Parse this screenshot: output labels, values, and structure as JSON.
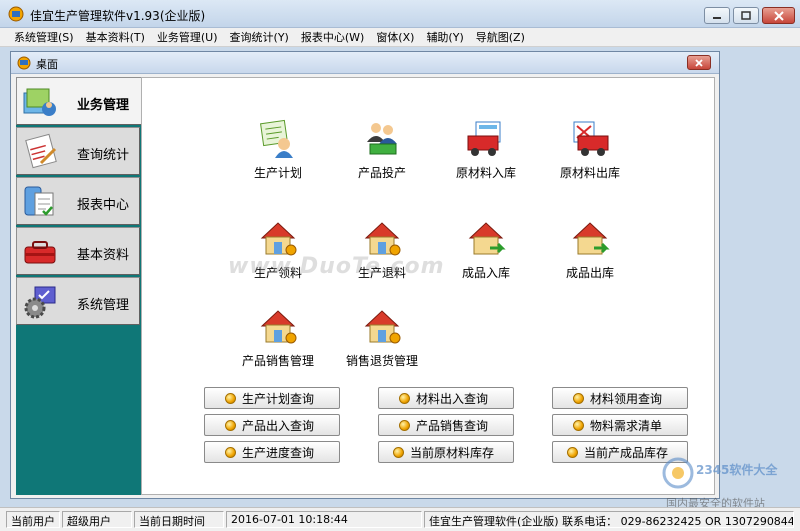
{
  "window": {
    "title": "佳宜生产管理软件v1.93(企业版)"
  },
  "menubar": [
    "系统管理(S)",
    "基本资料(T)",
    "业务管理(U)",
    "查询统计(Y)",
    "报表中心(W)",
    "窗体(X)",
    "辅助(Y)",
    "导航图(Z)"
  ],
  "desktop": {
    "title": "桌面"
  },
  "sidebar": {
    "items": [
      {
        "label": "业务管理",
        "icon": "business-icon",
        "active": true
      },
      {
        "label": "查询统计",
        "icon": "query-icon",
        "active": false
      },
      {
        "label": "报表中心",
        "icon": "report-icon",
        "active": false
      },
      {
        "label": "基本资料",
        "icon": "toolbox-icon",
        "active": false
      },
      {
        "label": "系统管理",
        "icon": "settings-gear-icon",
        "active": false
      }
    ]
  },
  "tiles": [
    {
      "label": "生产计划",
      "icon": "production-plan-icon"
    },
    {
      "label": "产品投产",
      "icon": "product-launch-icon"
    },
    {
      "label": "原材料入库",
      "icon": "material-in-icon"
    },
    {
      "label": "原材料出库",
      "icon": "material-out-icon"
    },
    {
      "label": "生产领料",
      "icon": "house-icon"
    },
    {
      "label": "生产退料",
      "icon": "house-icon"
    },
    {
      "label": "成品入库",
      "icon": "house-arrow-icon"
    },
    {
      "label": "成品出库",
      "icon": "house-arrow-icon"
    },
    {
      "label": "产品销售管理",
      "icon": "house-icon"
    },
    {
      "label": "销售退货管理",
      "icon": "house-icon"
    }
  ],
  "query_buttons": [
    "生产计划查询",
    "材料出入查询",
    "材料领用查询",
    "产品出入查询",
    "产品销售查询",
    "物料需求清单",
    "生产进度查询",
    "当前原材料库存",
    "当前产成品库存"
  ],
  "statusbar": {
    "user_label": "当前用户",
    "user_value": "超级用户",
    "datetime_label": "当前日期时间",
    "datetime_value": "2016-07-01 10:18:44",
    "info": "佳宜生产管理软件(企业版) 联系电话： 029-86232425 OR 1307290844"
  },
  "watermarks": {
    "center": "www.DuoTe.com",
    "corner_brand": "2345软件大全",
    "corner_text": "国内最安全的软件站"
  },
  "colors": {
    "sidebar_bg": "#0f7777",
    "accent_orange": "#f0a400"
  }
}
